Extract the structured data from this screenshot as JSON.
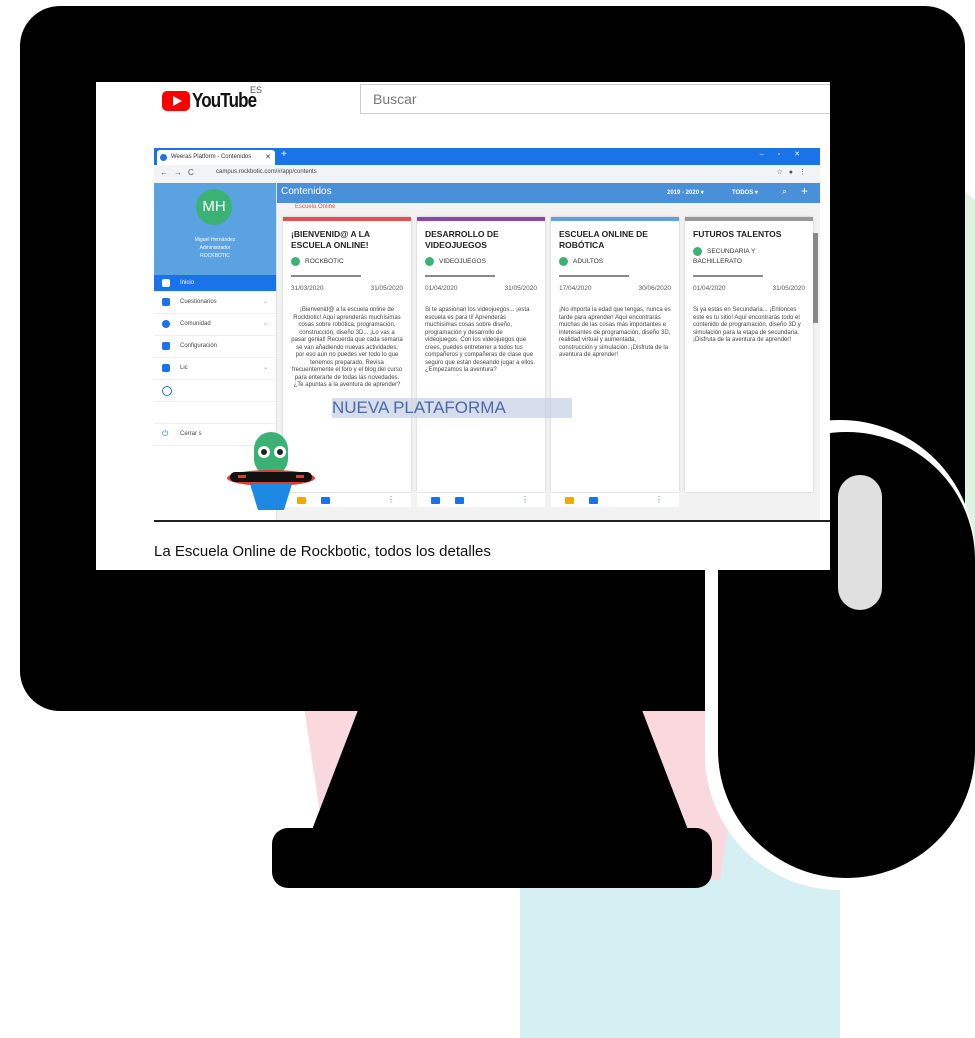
{
  "colors": {
    "monitor": "#000000",
    "youtube_red": "#ff0000",
    "chrome_blue": "#1a73e8",
    "app_blue": "#4a90d9",
    "avatar_green": "#3bb273",
    "bg_teal": "#d6eff3",
    "bg_pink": "#f9d9de",
    "bg_green": "#dff3e2"
  },
  "youtube": {
    "logo_text": "YouTube",
    "region": "ES",
    "search_placeholder": "Buscar"
  },
  "browser": {
    "tab_title": "Weeras Platform - Contenidos",
    "url": "campus.rockbotic.com/#/app/contents"
  },
  "sidebar": {
    "avatar_initials": "MH",
    "user_name": "Miguel Hernández",
    "user_role": "Administrador",
    "user_org": "ROCKBOTIC",
    "items": [
      {
        "label": "Inicio"
      },
      {
        "label": "Cuestionarios"
      },
      {
        "label": "Comunidad"
      },
      {
        "label": "Configuración"
      },
      {
        "label": "Lic"
      },
      {
        "label": ""
      },
      {
        "label": ""
      },
      {
        "label": "Cerrar s"
      }
    ]
  },
  "appbar": {
    "title": "Contenidos",
    "year": "2019 - 2020 ▾",
    "filter": "TODOS ▾"
  },
  "banner_fragment": "Escuela Online",
  "cards": [
    {
      "title": "¡BIENVENID@ A LA ESCUELA ONLINE!",
      "tag": "ROCKBOTIC",
      "start": "31/03/2020",
      "end": "31/05/2020",
      "body": "¡Bienvenid@ a la escuela online de Rockbotic! Aquí aprenderás muchísimas cosas sobre robótica, programación, construcción, diseño 3D... ¡Lo vas a pasar genial! Recuerda que cada semana se van añadiendo nuevas actividades, por eso aún no puedes ver todo lo que tenemos preparado. Revisa frecuentemente el foro y el blog del curso para enterarte de todas las novedades. ¿Te apuntas a la aventura de aprender?"
    },
    {
      "title": "DESARROLLO DE VIDEOJUEGOS",
      "tag": "VIDEOJUEGOS",
      "start": "01/04/2020",
      "end": "31/05/2020",
      "body": "Si te apasionan los videojuegos... ¡esta escuela es para ti! Aprenderás muchísimas cosas sobre diseño, programación y desarrollo de videojuegos. Con los videojuegos que crees, puedes entretener a todos tus compañeros y compañeras de clase que seguro que están deseando jugar a ellos. ¿Empezamos la aventura?"
    },
    {
      "title": "ESCUELA ONLINE DE ROBÓTICA",
      "tag": "ADULTOS",
      "start": "17/04/2020",
      "end": "30/06/2020",
      "body": "¡No importa la edad que tengas, nunca es tarde para aprender! Aquí encontrarás muchas de las cosas más importantes e interesantes de programación, diseño 3D, realidad virtual y aumentada, construcción y simulación. ¡Disfruta de la aventura de aprender!"
    },
    {
      "title": "FUTUROS TALENTOS",
      "tag": "SECUNDARIA Y BACHILLERATO",
      "start": "01/04/2020",
      "end": "31/05/2020",
      "body": "Si ya estás en Secundaria... ¡Entonces este es tu sitio! Aquí encontrarás todo el contenido de programación, diseño 3D y simulación para la etapa de secundaria. ¡Disfruta de la aventura de aprender!"
    }
  ],
  "overlay_text": "NUEVA PLATAFORMA",
  "video_caption": "La Escuela Online de Rockbotic, todos los detalles"
}
